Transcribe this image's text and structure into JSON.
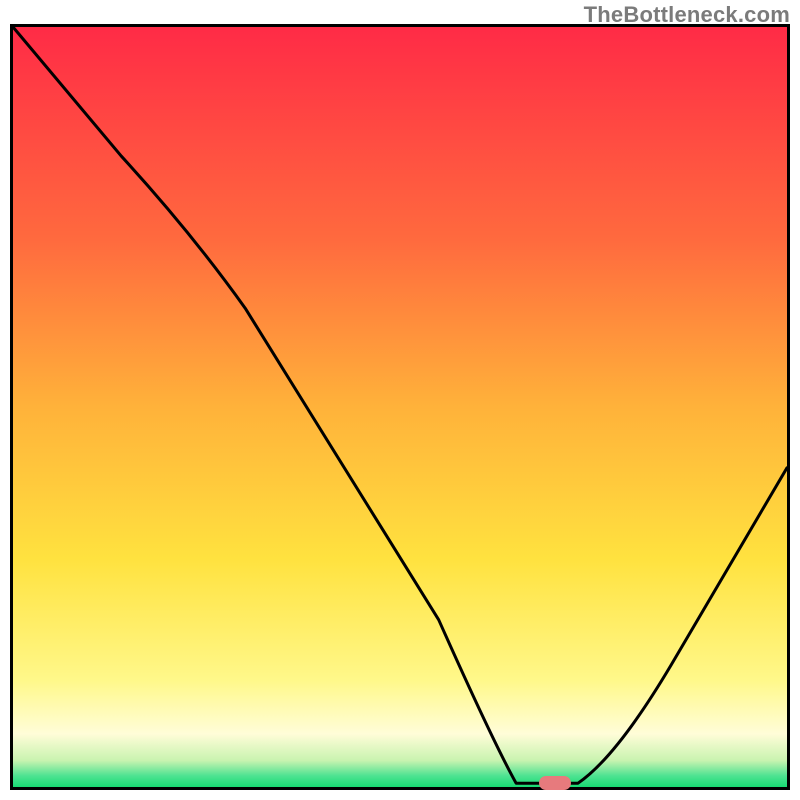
{
  "watermark": "TheBottleneck.com",
  "colors": {
    "top": "#ff2b46",
    "mid1": "#ff8a3a",
    "mid2": "#ffd23a",
    "yellow": "#ffee55",
    "paleyellow": "#fffca8",
    "green": "#1de27a",
    "border": "#000000",
    "marker": "#e77a7d"
  },
  "chart_data": {
    "type": "line",
    "title": "",
    "xlabel": "",
    "ylabel": "",
    "xlim": [
      0,
      100
    ],
    "ylim": [
      0,
      100
    ],
    "x": [
      0,
      15,
      30,
      45,
      58,
      63,
      68,
      73,
      80,
      90,
      100
    ],
    "values": [
      100,
      82,
      68,
      49,
      25,
      8,
      0,
      0,
      7,
      24,
      42
    ],
    "marker": {
      "x": 70,
      "y": 0
    },
    "gradient_stops": [
      {
        "pos": 0.0,
        "color": "#ff2b46"
      },
      {
        "pos": 0.28,
        "color": "#ff6a3e"
      },
      {
        "pos": 0.5,
        "color": "#ffb23a"
      },
      {
        "pos": 0.7,
        "color": "#ffe23f"
      },
      {
        "pos": 0.86,
        "color": "#fff88a"
      },
      {
        "pos": 0.93,
        "color": "#fffdd8"
      },
      {
        "pos": 0.965,
        "color": "#c9f3b0"
      },
      {
        "pos": 0.985,
        "color": "#4fe392"
      },
      {
        "pos": 1.0,
        "color": "#18db73"
      }
    ]
  }
}
